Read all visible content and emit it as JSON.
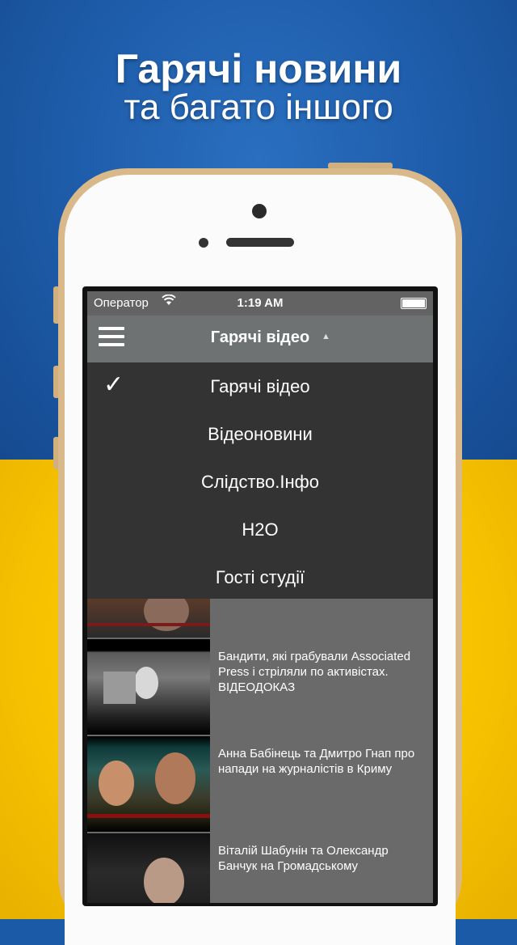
{
  "headline": {
    "line1": "Гарячі новини",
    "line2": "та багато іншого"
  },
  "statusbar": {
    "carrier": "Оператор",
    "time": "1:19 AM"
  },
  "navbar": {
    "title": "Гарячі відео"
  },
  "dropdown": {
    "items": [
      {
        "label": "Гарячі відео",
        "selected": true
      },
      {
        "label": "Відеоновини",
        "selected": false
      },
      {
        "label": "Слідство.Інфо",
        "selected": false
      },
      {
        "label": "H2O",
        "selected": false
      },
      {
        "label": "Гості студії",
        "selected": false
      }
    ],
    "check_mark": "✓"
  },
  "videos": [
    {
      "title": ""
    },
    {
      "title": "Бандити, які грабували Associated Press і стріляли по активістах. ВІДЕОДОКАЗ"
    },
    {
      "title": "Анна Бабінець та Дмитро Гнап про напади на журналістів в Криму"
    },
    {
      "title": "Віталій Шабунін та Олександр Банчук на Громадському"
    }
  ],
  "colors": {
    "flag_blue": "#1d5ba8",
    "flag_yellow": "#f7c300",
    "phone_gold": "#d9b98a",
    "dropdown_bg": "#333333",
    "navbar_bg": "#6f7273"
  },
  "icons": {
    "menu": "hamburger-icon",
    "wifi": "wifi-icon",
    "battery": "battery-icon",
    "caret": "caret-up-icon",
    "check": "checkmark-icon"
  }
}
